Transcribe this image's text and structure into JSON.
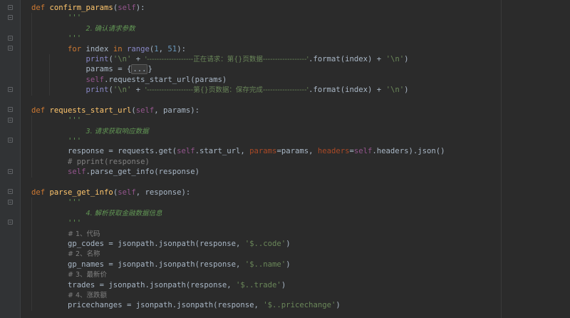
{
  "code": {
    "l1": {
      "def": "def ",
      "name": "confirm_params",
      "open": "(",
      "self": "self",
      "close": "):"
    },
    "l2": {
      "text": "'''"
    },
    "l3": {
      "text": "2. 确认请求参数"
    },
    "l4": {
      "text": "'''"
    },
    "l5": {
      "for": "for",
      "sp1": " index ",
      "in": "in",
      "sp2": " ",
      "range": "range",
      "p1": "(",
      "n1": "1",
      "comma": ", ",
      "n2": "51",
      "p2": "):"
    },
    "l6": {
      "print": "print",
      "p1": "(",
      "s1": "'\\n'",
      "plus1": " + ",
      "s2": "'-------------------正在请求：第{}页数据------------------'",
      "fmt": ".format(index) + ",
      "s3": "'\\n'",
      "p2": ")"
    },
    "l7": {
      "pre": "params = {",
      "fold": "...",
      "post": "}"
    },
    "l8": {
      "self": "self",
      "rest": ".requests_start_url(params)"
    },
    "l9": {
      "print": "print",
      "p1": "(",
      "s1": "'\\n'",
      "plus1": " + ",
      "s2": "'-------------------第{}页数据：保存完成------------------'",
      "fmt": ".format(index) + ",
      "s3": "'\\n'",
      "p2": ")"
    },
    "l11": {
      "def": "def ",
      "name": "requests_start_url",
      "open": "(",
      "self": "self",
      "rest": ", params):"
    },
    "l12": {
      "text": "'''"
    },
    "l13": {
      "text": "3. 请求获取响应数据"
    },
    "l14": {
      "text": "'''"
    },
    "l15": {
      "a": "response = requests.get(",
      "self1": "self",
      "b": ".start_url, ",
      "kw1": "params",
      "c": "=params, ",
      "kw2": "headers",
      "d": "=",
      "self2": "self",
      "e": ".headers).json()"
    },
    "l16": {
      "text": "# pprint(response)"
    },
    "l17": {
      "self": "self",
      "rest": ".parse_get_info(response)"
    },
    "l19": {
      "def": "def ",
      "name": "parse_get_info",
      "open": "(",
      "self": "self",
      "rest": ", response):"
    },
    "l20": {
      "text": "'''"
    },
    "l21": {
      "text": "4. 解析获取金融数据信息"
    },
    "l22": {
      "text": "'''"
    },
    "l23": {
      "text": "# 1、代码"
    },
    "l24": {
      "a": "gp_codes = jsonpath.jsonpath(response, ",
      "s": "'$..code'",
      "b": ")"
    },
    "l25": {
      "text": "# 2、名称"
    },
    "l26": {
      "a": "gp_names = jsonpath.jsonpath(response, ",
      "s": "'$..name'",
      "b": ")"
    },
    "l27": {
      "text": "# 3、最新价"
    },
    "l28": {
      "a": "trades = jsonpath.jsonpath(response, ",
      "s": "'$..trade'",
      "b": ")"
    },
    "l29": {
      "text": "# 4、涨跌额"
    },
    "l30": {
      "a": "pricechanges = jsonpath.jsonpath(response, ",
      "s": "'$..pricechange'",
      "b": ")"
    }
  }
}
